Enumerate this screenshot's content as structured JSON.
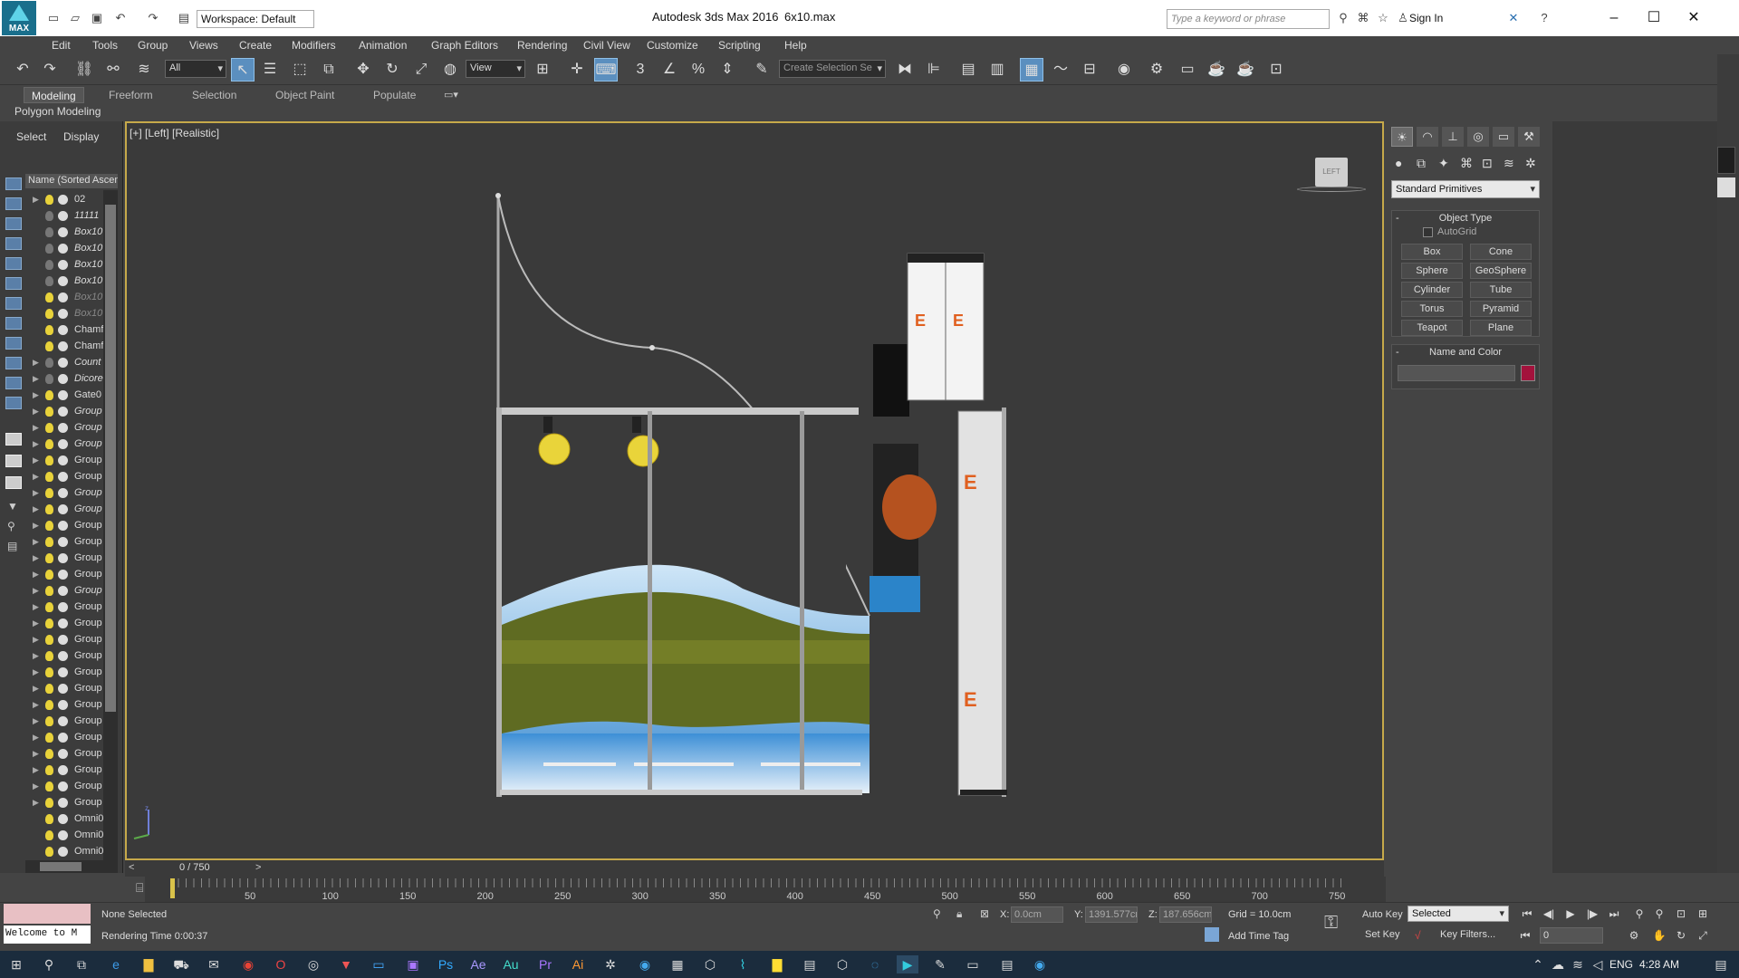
{
  "titlebar": {
    "app_title": "Autodesk 3ds Max 2016",
    "file_name": "6x10.max",
    "workspace": "Workspace: Default",
    "search_placeholder": "Type a keyword or phrase",
    "sign_in": "Sign In",
    "logo_text": "MAX"
  },
  "menu": [
    "Edit",
    "Tools",
    "Group",
    "Views",
    "Create",
    "Modifiers",
    "Animation",
    "Graph Editors",
    "Rendering",
    "Civil View",
    "Customize",
    "Scripting",
    "Help"
  ],
  "toolbar": {
    "selection_filter": "All",
    "ref_coord": "View",
    "named_selection_placeholder": "Create Selection Se"
  },
  "ribbon": {
    "tabs": [
      "Modeling",
      "Freeform",
      "Selection",
      "Object Paint",
      "Populate"
    ],
    "active_tab": "Modeling",
    "panel": "Polygon Modeling"
  },
  "scene_explorer": {
    "tabs": [
      "Select",
      "Display"
    ],
    "column_header": "Name (Sorted Ascen",
    "rows": [
      {
        "label": "02",
        "expand": true,
        "light": "on",
        "style": "normal"
      },
      {
        "label": "11111",
        "expand": false,
        "light": "off",
        "style": "italic"
      },
      {
        "label": "Box10",
        "expand": false,
        "light": "off",
        "style": "italic"
      },
      {
        "label": "Box10",
        "expand": false,
        "light": "off",
        "style": "italic"
      },
      {
        "label": "Box10",
        "expand": false,
        "light": "off",
        "style": "italic"
      },
      {
        "label": "Box10",
        "expand": false,
        "light": "off",
        "style": "italic"
      },
      {
        "label": "Box10",
        "expand": false,
        "light": "on",
        "style": "dim"
      },
      {
        "label": "Box10",
        "expand": false,
        "light": "on",
        "style": "dim"
      },
      {
        "label": "Chamf",
        "expand": false,
        "light": "on",
        "style": "normal"
      },
      {
        "label": "Chamf",
        "expand": false,
        "light": "on",
        "style": "normal"
      },
      {
        "label": "Count",
        "expand": true,
        "light": "off",
        "style": "italic"
      },
      {
        "label": "Dicore",
        "expand": true,
        "light": "off",
        "style": "italic"
      },
      {
        "label": "Gate0",
        "expand": true,
        "light": "on",
        "style": "normal"
      },
      {
        "label": "Group",
        "expand": true,
        "light": "on",
        "style": "italic"
      },
      {
        "label": "Group",
        "expand": true,
        "light": "on",
        "style": "italic"
      },
      {
        "label": "Group",
        "expand": true,
        "light": "on",
        "style": "italic"
      },
      {
        "label": "Group",
        "expand": true,
        "light": "on",
        "style": "normal"
      },
      {
        "label": "Group",
        "expand": true,
        "light": "on",
        "style": "normal"
      },
      {
        "label": "Group",
        "expand": true,
        "light": "on",
        "style": "italic"
      },
      {
        "label": "Group",
        "expand": true,
        "light": "on",
        "style": "italic"
      },
      {
        "label": "Group",
        "expand": true,
        "light": "on",
        "style": "normal"
      },
      {
        "label": "Group",
        "expand": true,
        "light": "on",
        "style": "normal"
      },
      {
        "label": "Group",
        "expand": true,
        "light": "on",
        "style": "normal"
      },
      {
        "label": "Group",
        "expand": true,
        "light": "on",
        "style": "normal"
      },
      {
        "label": "Group",
        "expand": true,
        "light": "on",
        "style": "italic"
      },
      {
        "label": "Group",
        "expand": true,
        "light": "on",
        "style": "normal"
      },
      {
        "label": "Group",
        "expand": true,
        "light": "on",
        "style": "normal"
      },
      {
        "label": "Group",
        "expand": true,
        "light": "on",
        "style": "normal"
      },
      {
        "label": "Group",
        "expand": true,
        "light": "on",
        "style": "normal"
      },
      {
        "label": "Group",
        "expand": true,
        "light": "on",
        "style": "normal"
      },
      {
        "label": "Group",
        "expand": true,
        "light": "on",
        "style": "normal"
      },
      {
        "label": "Group",
        "expand": true,
        "light": "on",
        "style": "normal"
      },
      {
        "label": "Group",
        "expand": true,
        "light": "on",
        "style": "normal"
      },
      {
        "label": "Group",
        "expand": true,
        "light": "on",
        "style": "normal"
      },
      {
        "label": "Group",
        "expand": true,
        "light": "on",
        "style": "normal"
      },
      {
        "label": "Group",
        "expand": true,
        "light": "on",
        "style": "normal"
      },
      {
        "label": "Group",
        "expand": true,
        "light": "on",
        "style": "normal"
      },
      {
        "label": "Group",
        "expand": true,
        "light": "on",
        "style": "normal"
      },
      {
        "label": "Omni0",
        "expand": false,
        "light": "on",
        "style": "normal"
      },
      {
        "label": "Omni0",
        "expand": false,
        "light": "on",
        "style": "normal"
      },
      {
        "label": "Omni0",
        "expand": false,
        "light": "on",
        "style": "normal"
      }
    ]
  },
  "viewport": {
    "label": "[+] [Left] [Realistic]",
    "viewcube_label": "LEFT"
  },
  "command_panel": {
    "category": "Standard Primitives",
    "object_type_title": "Object Type",
    "autogrid": "AutoGrid",
    "primitives": [
      "Box",
      "Cone",
      "Sphere",
      "GeoSphere",
      "Cylinder",
      "Tube",
      "Torus",
      "Pyramid",
      "Teapot",
      "Plane"
    ],
    "name_color_title": "Name and Color",
    "object_color": "#a3123c"
  },
  "timeline": {
    "frame_counter": "0 / 750",
    "ticks": [
      "50",
      "100",
      "150",
      "200",
      "250",
      "300",
      "350",
      "400",
      "450",
      "500",
      "550",
      "600",
      "650",
      "700",
      "750"
    ]
  },
  "status": {
    "listener": "Welcome to M",
    "selection": "None Selected",
    "render_time": "Rendering Time  0:00:37",
    "x_label": "X:",
    "x": "0.0cm",
    "y_label": "Y:",
    "y": "1391.577cm",
    "z_label": "Z:",
    "z": "187.656cm",
    "grid": "Grid = 10.0cm",
    "add_time_tag": "Add Time Tag",
    "auto_key": "Auto Key",
    "set_key": "Set Key",
    "key_mode": "Selected",
    "key_filters": "Key Filters...",
    "current_frame": "0"
  },
  "taskbar": {
    "language": "ENG",
    "time": "4:28 AM"
  },
  "colors": {
    "accent": "#5b8fbf",
    "viewport_border": "#c6a94a",
    "object_color": "#a3123c"
  }
}
